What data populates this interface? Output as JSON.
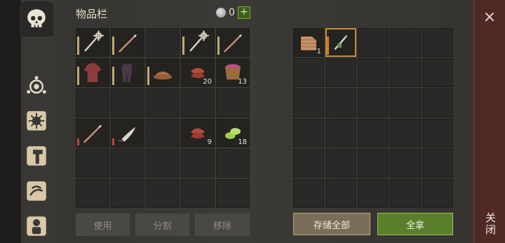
{
  "inventory": {
    "title": "物品栏",
    "currency_value": "0",
    "add_label": "+"
  },
  "player_grid": {
    "rows": [
      [
        {
          "item": "spiked-mace-icon"
        },
        {
          "item": "spear-icon"
        },
        {
          "item": ""
        },
        {
          "item": "spiked-mace-icon"
        },
        {
          "item": "spear-icon"
        }
      ],
      [
        {
          "item": "armor-shirt-icon"
        },
        {
          "item": "armor-pants-icon"
        },
        {
          "item": "leather-hat-icon"
        },
        {
          "item": "raw-meat-icon",
          "qty": "20"
        },
        {
          "item": "berry-bucket-icon",
          "qty": "13"
        }
      ],
      [
        {
          "item": ""
        },
        {
          "item": ""
        },
        {
          "item": ""
        },
        {
          "item": ""
        },
        {
          "item": ""
        }
      ],
      [
        {
          "item": "spear-icon"
        },
        {
          "item": "machete-icon"
        },
        {
          "item": ""
        },
        {
          "item": "raw-meat-icon",
          "qty": "9"
        },
        {
          "item": "cactus-slices-icon",
          "qty": "18"
        }
      ],
      [
        {
          "item": ""
        },
        {
          "item": ""
        },
        {
          "item": ""
        },
        {
          "item": ""
        },
        {
          "item": ""
        }
      ],
      [
        {
          "item": ""
        },
        {
          "item": ""
        },
        {
          "item": ""
        },
        {
          "item": ""
        },
        {
          "item": ""
        }
      ]
    ]
  },
  "container_grid": {
    "rows": [
      [
        {
          "item": "cloth-icon",
          "qty": "1"
        },
        {
          "item": "wrapped-arrow-icon"
        },
        {
          "item": ""
        },
        {
          "item": ""
        },
        {
          "item": ""
        }
      ],
      [
        {
          "item": ""
        },
        {
          "item": ""
        },
        {
          "item": ""
        },
        {
          "item": ""
        },
        {
          "item": ""
        }
      ],
      [
        {
          "item": ""
        },
        {
          "item": ""
        },
        {
          "item": ""
        },
        {
          "item": ""
        },
        {
          "item": ""
        }
      ],
      [
        {
          "item": ""
        },
        {
          "item": ""
        },
        {
          "item": ""
        },
        {
          "item": ""
        },
        {
          "item": ""
        }
      ],
      [
        {
          "item": ""
        },
        {
          "item": ""
        },
        {
          "item": ""
        },
        {
          "item": ""
        },
        {
          "item": ""
        }
      ],
      [
        {
          "item": ""
        },
        {
          "item": ""
        },
        {
          "item": ""
        },
        {
          "item": ""
        },
        {
          "item": ""
        }
      ]
    ]
  },
  "buttons": {
    "use": "使用",
    "split": "分割",
    "remove": "移除",
    "store_all": "存储全部",
    "take_all": "全拿"
  },
  "close": {
    "label": "关闭",
    "x": "×"
  },
  "colors": {
    "take_all_bg": "#5a7e2c",
    "close_bar_bg": "#4f2a25"
  }
}
